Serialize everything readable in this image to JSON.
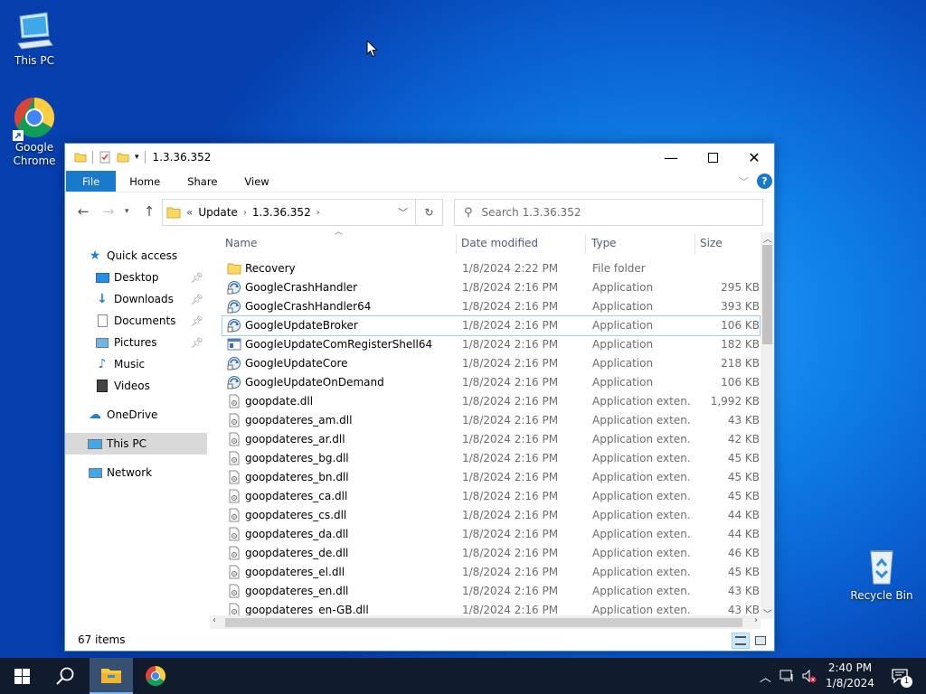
{
  "desktop": {
    "icons": [
      {
        "label": "This PC"
      },
      {
        "label": "Google Chrome"
      },
      {
        "label": "Recycle Bin"
      }
    ]
  },
  "window": {
    "title": "1.3.36.352",
    "ribbon_tabs": [
      "File",
      "Home",
      "Share",
      "View"
    ],
    "breadcrumb": [
      "Update",
      "1.3.36.352"
    ],
    "breadcrumb_overflow": "«",
    "search_placeholder": "Search 1.3.36.352",
    "nav": {
      "quick_access": "Quick access",
      "items": [
        {
          "label": "Desktop",
          "pinned": true
        },
        {
          "label": "Downloads",
          "pinned": true
        },
        {
          "label": "Documents",
          "pinned": true
        },
        {
          "label": "Pictures",
          "pinned": true
        },
        {
          "label": "Music",
          "pinned": false
        },
        {
          "label": "Videos",
          "pinned": false
        }
      ],
      "onedrive": "OneDrive",
      "this_pc": "This PC",
      "network": "Network"
    },
    "columns": {
      "name": "Name",
      "date": "Date modified",
      "type": "Type",
      "size": "Size"
    },
    "files": [
      {
        "name": "Recovery",
        "date": "1/8/2024 2:22 PM",
        "type": "File folder",
        "size": "",
        "kind": "folder"
      },
      {
        "name": "GoogleCrashHandler",
        "date": "1/8/2024 2:16 PM",
        "type": "Application",
        "size": "295 KB",
        "kind": "app"
      },
      {
        "name": "GoogleCrashHandler64",
        "date": "1/8/2024 2:16 PM",
        "type": "Application",
        "size": "393 KB",
        "kind": "app"
      },
      {
        "name": "GoogleUpdateBroker",
        "date": "1/8/2024 2:16 PM",
        "type": "Application",
        "size": "106 KB",
        "kind": "app"
      },
      {
        "name": "GoogleUpdateComRegisterShell64",
        "date": "1/8/2024 2:16 PM",
        "type": "Application",
        "size": "182 KB",
        "kind": "exe"
      },
      {
        "name": "GoogleUpdateCore",
        "date": "1/8/2024 2:16 PM",
        "type": "Application",
        "size": "218 KB",
        "kind": "app"
      },
      {
        "name": "GoogleUpdateOnDemand",
        "date": "1/8/2024 2:16 PM",
        "type": "Application",
        "size": "106 KB",
        "kind": "app"
      },
      {
        "name": "goopdate.dll",
        "date": "1/8/2024 2:16 PM",
        "type": "Application exten...",
        "size": "1,992 KB",
        "kind": "dll"
      },
      {
        "name": "goopdateres_am.dll",
        "date": "1/8/2024 2:16 PM",
        "type": "Application exten...",
        "size": "43 KB",
        "kind": "dll"
      },
      {
        "name": "goopdateres_ar.dll",
        "date": "1/8/2024 2:16 PM",
        "type": "Application exten...",
        "size": "42 KB",
        "kind": "dll"
      },
      {
        "name": "goopdateres_bg.dll",
        "date": "1/8/2024 2:16 PM",
        "type": "Application exten...",
        "size": "45 KB",
        "kind": "dll"
      },
      {
        "name": "goopdateres_bn.dll",
        "date": "1/8/2024 2:16 PM",
        "type": "Application exten...",
        "size": "45 KB",
        "kind": "dll"
      },
      {
        "name": "goopdateres_ca.dll",
        "date": "1/8/2024 2:16 PM",
        "type": "Application exten...",
        "size": "45 KB",
        "kind": "dll"
      },
      {
        "name": "goopdateres_cs.dll",
        "date": "1/8/2024 2:16 PM",
        "type": "Application exten...",
        "size": "44 KB",
        "kind": "dll"
      },
      {
        "name": "goopdateres_da.dll",
        "date": "1/8/2024 2:16 PM",
        "type": "Application exten...",
        "size": "44 KB",
        "kind": "dll"
      },
      {
        "name": "goopdateres_de.dll",
        "date": "1/8/2024 2:16 PM",
        "type": "Application exten...",
        "size": "46 KB",
        "kind": "dll"
      },
      {
        "name": "goopdateres_el.dll",
        "date": "1/8/2024 2:16 PM",
        "type": "Application exten...",
        "size": "45 KB",
        "kind": "dll"
      },
      {
        "name": "goopdateres_en.dll",
        "date": "1/8/2024 2:16 PM",
        "type": "Application exten...",
        "size": "43 KB",
        "kind": "dll"
      },
      {
        "name": "goopdateres_en-GB.dll",
        "date": "1/8/2024 2:16 PM",
        "type": "Application exten...",
        "size": "43 KB",
        "kind": "dll"
      }
    ],
    "selected_file": "GoogleUpdateBroker",
    "status": "67 items"
  },
  "taskbar": {
    "time": "2:40 PM",
    "date": "1/8/2024",
    "notification_count": "1"
  },
  "colors": {
    "file_tab": "#1979ca",
    "selection": "#cce8ff",
    "taskbar": "#101b2d"
  }
}
